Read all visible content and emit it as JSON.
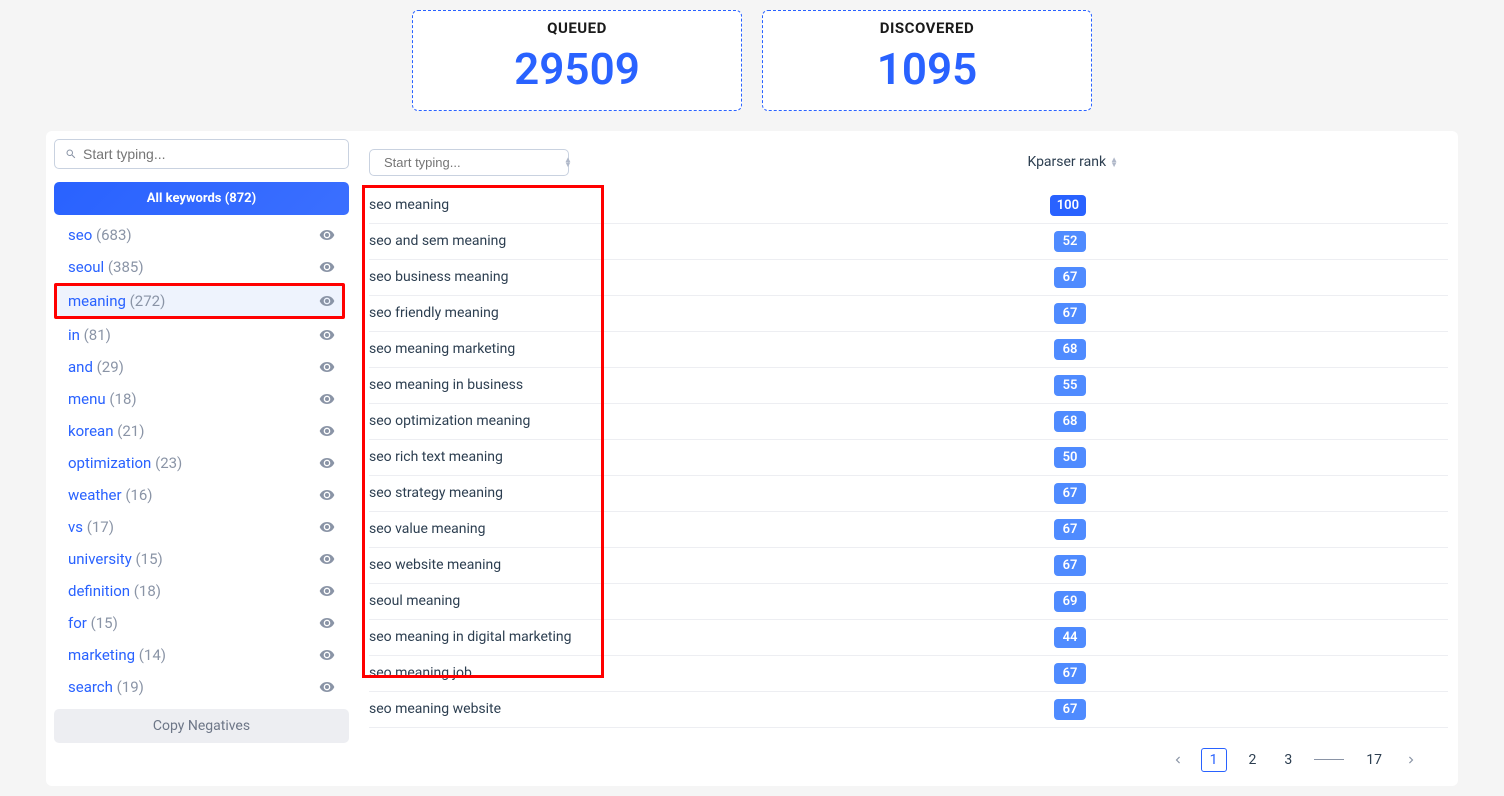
{
  "stats": {
    "queued": {
      "label": "QUEUED",
      "value": "29509"
    },
    "discovered": {
      "label": "DISCOVERED",
      "value": "1095"
    }
  },
  "sidebar": {
    "search_placeholder": "Start typing...",
    "all_keywords_label": "All keywords (872)",
    "copy_negatives_label": "Copy Negatives",
    "items": [
      {
        "name": "seo",
        "count": "(683)"
      },
      {
        "name": "seoul",
        "count": "(385)"
      },
      {
        "name": "meaning",
        "count": "(272)",
        "active": true,
        "highlighted": true
      },
      {
        "name": "in",
        "count": "(81)"
      },
      {
        "name": "and",
        "count": "(29)"
      },
      {
        "name": "menu",
        "count": "(18)"
      },
      {
        "name": "korean",
        "count": "(21)"
      },
      {
        "name": "optimization",
        "count": "(23)"
      },
      {
        "name": "weather",
        "count": "(16)"
      },
      {
        "name": "vs",
        "count": "(17)"
      },
      {
        "name": "university",
        "count": "(15)"
      },
      {
        "name": "definition",
        "count": "(18)"
      },
      {
        "name": "for",
        "count": "(15)"
      },
      {
        "name": "marketing",
        "count": "(14)"
      },
      {
        "name": "search",
        "count": "(19)"
      }
    ]
  },
  "content": {
    "search_placeholder": "Start typing...",
    "rank_header": "Kparser rank",
    "rows": [
      {
        "keyword": "seo meaning",
        "rank": "100",
        "dark": true
      },
      {
        "keyword": "seo and sem meaning",
        "rank": "52"
      },
      {
        "keyword": "seo business meaning",
        "rank": "67"
      },
      {
        "keyword": "seo friendly meaning",
        "rank": "67"
      },
      {
        "keyword": "seo meaning marketing",
        "rank": "68"
      },
      {
        "keyword": "seo meaning in business",
        "rank": "55"
      },
      {
        "keyword": "seo optimization meaning",
        "rank": "68"
      },
      {
        "keyword": "seo rich text meaning",
        "rank": "50"
      },
      {
        "keyword": "seo strategy meaning",
        "rank": "67"
      },
      {
        "keyword": "seo value meaning",
        "rank": "67"
      },
      {
        "keyword": "seo website meaning",
        "rank": "67"
      },
      {
        "keyword": "seoul meaning",
        "rank": "69"
      },
      {
        "keyword": "seo meaning in digital marketing",
        "rank": "44"
      },
      {
        "keyword": "seo meaning job",
        "rank": "67"
      },
      {
        "keyword": "seo meaning website",
        "rank": "67"
      }
    ]
  },
  "pagination": {
    "pages": [
      "1",
      "2",
      "3"
    ],
    "last": "17",
    "active": "1"
  }
}
